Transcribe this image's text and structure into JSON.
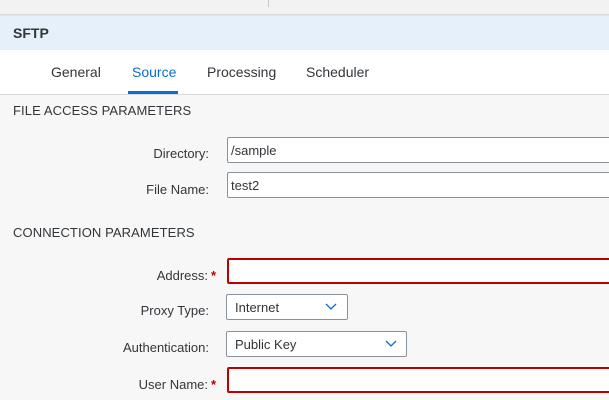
{
  "header": {
    "title": "SFTP"
  },
  "tabs": [
    {
      "label": "General"
    },
    {
      "label": "Source"
    },
    {
      "label": "Processing"
    },
    {
      "label": "Scheduler"
    }
  ],
  "file_access": {
    "section_title": "FILE ACCESS PARAMETERS",
    "directory": {
      "label": "Directory:",
      "value": "/sample"
    },
    "file_name": {
      "label": "File Name:",
      "value": "test2"
    }
  },
  "connection": {
    "section_title": "CONNECTION PARAMETERS",
    "address": {
      "label": "Address:",
      "value": "",
      "required_mark": "*"
    },
    "proxy_type": {
      "label": "Proxy Type:",
      "selected": "Internet"
    },
    "authentication": {
      "label": "Authentication:",
      "selected": "Public Key"
    },
    "user_name": {
      "label": "User Name:",
      "value": "",
      "required_mark": "*"
    }
  },
  "colors": {
    "accent": "#0a6ed1",
    "header_bg": "#e5f0fa",
    "error": "#bb0000"
  }
}
